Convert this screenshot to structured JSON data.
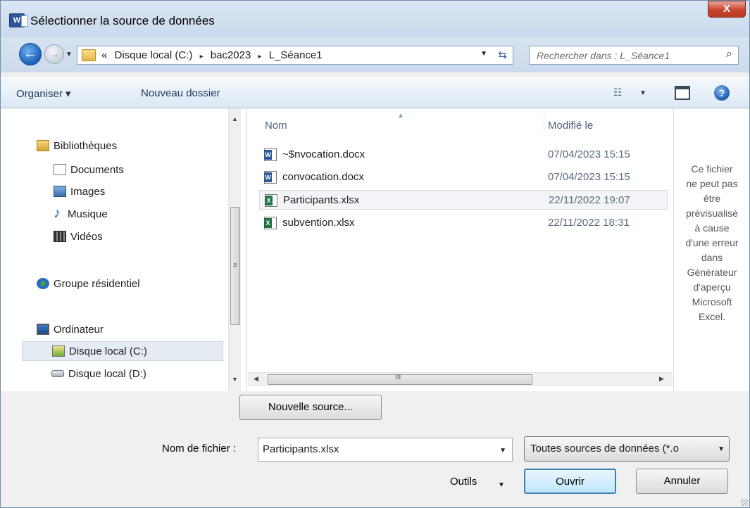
{
  "window": {
    "title": "Sélectionner la source de données",
    "close_label": "X",
    "app_icon_letter": "W"
  },
  "address": {
    "prefix": "«",
    "crumbs": [
      "Disque local (C:)",
      "bac2023",
      "L_Séance1"
    ],
    "separator": "▸"
  },
  "search": {
    "placeholder": "Rechercher dans : L_Séance1"
  },
  "toolbar": {
    "organize": "Organiser ▾",
    "new_folder": "Nouveau dossier"
  },
  "nav": {
    "items": [
      {
        "label": "Bibliothèques",
        "icon": "library-icon"
      },
      {
        "label": "Documents",
        "icon": "documents-icon"
      },
      {
        "label": "Images",
        "icon": "images-icon"
      },
      {
        "label": "Musique",
        "icon": "music-icon"
      },
      {
        "label": "Vidéos",
        "icon": "videos-icon"
      },
      {
        "label": "Groupe résidentiel",
        "icon": "homegroup-icon"
      },
      {
        "label": "Ordinateur",
        "icon": "computer-icon"
      },
      {
        "label": "Disque local (C:)",
        "icon": "drive-c-icon",
        "selected": true
      },
      {
        "label": "Disque local (D:)",
        "icon": "drive-d-icon"
      }
    ]
  },
  "files": {
    "columns": {
      "name": "Nom",
      "modified": "Modifié le"
    },
    "rows": [
      {
        "name": "~$nvocation.docx",
        "date": "07/04/2023 15:15",
        "type": "word"
      },
      {
        "name": "convocation.docx",
        "date": "07/04/2023 15:15",
        "type": "word"
      },
      {
        "name": "Participants.xlsx",
        "date": "22/11/2022 19:07",
        "type": "excel",
        "selected": true
      },
      {
        "name": "subvention.xlsx",
        "date": "22/11/2022 18:31",
        "type": "excel"
      }
    ]
  },
  "preview": {
    "lines": [
      "Ce fichier",
      "ne peut pas",
      "être",
      "prévisualisé",
      "à cause",
      "d'une erreur",
      "dans",
      "Générateur",
      "d'aperçu",
      "Microsoft",
      "Excel."
    ]
  },
  "bottom": {
    "new_source": "Nouvelle source...",
    "filename_label": "Nom de fichier :",
    "filename_value": "Participants.xlsx",
    "filetype_value": "Toutes sources de données (*.o",
    "tools": "Outils",
    "open": "Ouvrir",
    "cancel": "Annuler"
  },
  "scroll": {
    "grip_v": "≡",
    "grip_h": "III"
  }
}
